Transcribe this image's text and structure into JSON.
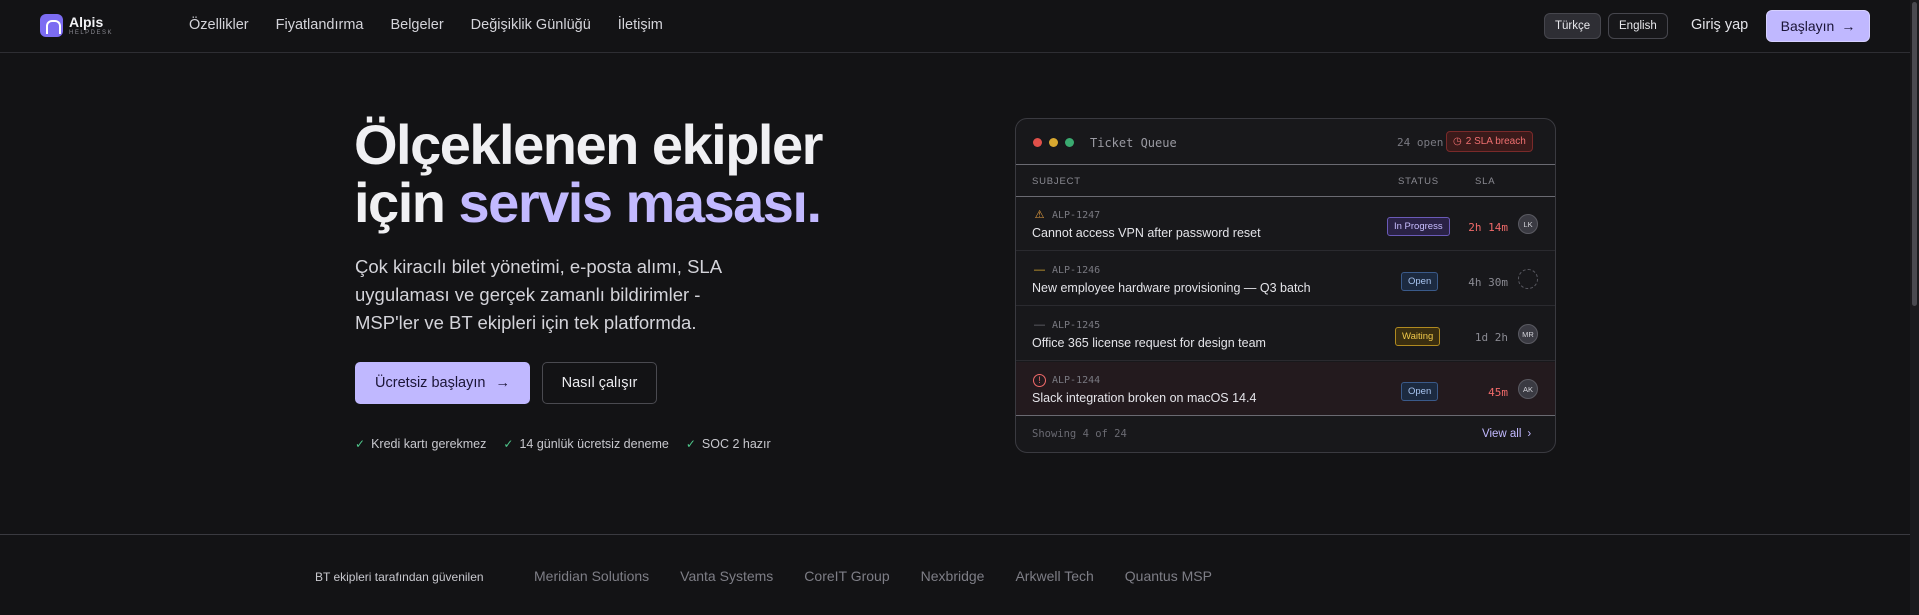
{
  "brand": {
    "name": "Alpis",
    "sub": "HELPDESK"
  },
  "nav": {
    "links": [
      "Özellikler",
      "Fiyatlandırma",
      "Belgeler",
      "Değişiklik Günlüğü",
      "İletişim"
    ],
    "lang_tr": "Türkçe",
    "lang_en": "English",
    "login": "Giriş yap",
    "start": "Başlayın"
  },
  "hero": {
    "title_line1": "Ölçeklenen ekipler",
    "title_line2_pre": "için ",
    "title_line2_accent": "servis masası.",
    "subtitle": "Çok kiracılı bilet yönetimi, e-posta alımı, SLA uygulaması ve gerçek zamanlı bildirimler - MSP'ler ve BT ekipleri için tek platformda.",
    "cta_primary": "Ücretsiz başlayın",
    "cta_secondary": "Nasıl çalışır",
    "checks": [
      "Kredi kartı gerekmez",
      "14 günlük ücretsiz deneme",
      "SOC 2 hazır"
    ]
  },
  "ticket_card": {
    "title": "Ticket Queue",
    "open_count": "24 open",
    "breach": "2 SLA breach",
    "columns": {
      "subject": "SUBJECT",
      "status": "STATUS",
      "sla": "SLA"
    },
    "rows": [
      {
        "id": "ALP-1247",
        "subject": "Cannot access VPN after password reset",
        "status": "In Progress",
        "sla": "2h 14m",
        "avatar": "LK",
        "priority": "warning-icon"
      },
      {
        "id": "ALP-1246",
        "subject": "New employee hardware provisioning — Q3 batch",
        "status": "Open",
        "sla": "4h 30m",
        "avatar": "",
        "priority": "medium-priority-icon"
      },
      {
        "id": "ALP-1245",
        "subject": "Office 365 license request for design team",
        "status": "Waiting",
        "sla": "1d 2h",
        "avatar": "MR",
        "priority": "low-priority-icon"
      },
      {
        "id": "ALP-1244",
        "subject": "Slack integration broken on macOS 14.4",
        "status": "Open",
        "sla": "45m",
        "avatar": "AK",
        "priority": "alert-icon"
      }
    ],
    "footer_showing": "Showing 4 of 24",
    "view_all": "View all"
  },
  "trust": {
    "label": "BT ekipleri tarafından güvenilen",
    "logos": [
      "Meridian Solutions",
      "Vanta Systems",
      "CoreIT Group",
      "Nexbridge",
      "Arkwell Tech",
      "Quantus MSP"
    ]
  },
  "colors": {
    "accent": "#c0b8ff",
    "background": "#131315",
    "danger": "#f06a6a",
    "success": "#4ec58a"
  }
}
